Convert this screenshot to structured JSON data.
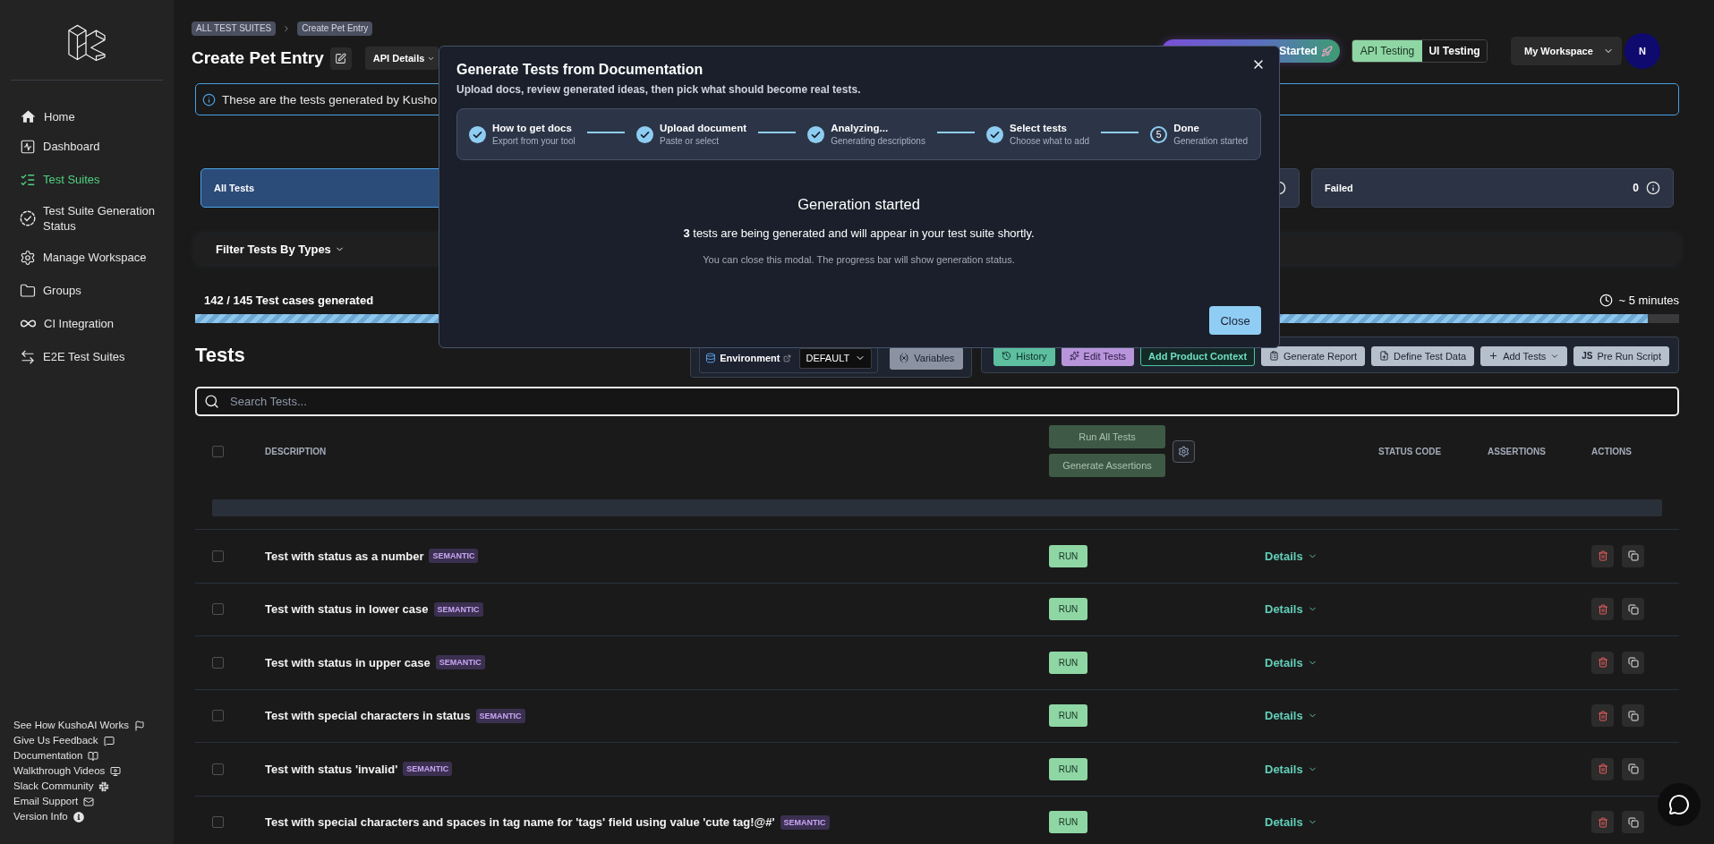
{
  "sidebar": {
    "nav": [
      {
        "label": "Home",
        "selected": false
      },
      {
        "label": "Dashboard",
        "selected": false
      },
      {
        "label": "Test Suites",
        "selected": true
      },
      {
        "label": "Test Suite Generation Status",
        "selected": false
      },
      {
        "label": "Manage Workspace",
        "selected": false
      },
      {
        "label": "Groups",
        "selected": false
      },
      {
        "label": "CI Integration",
        "selected": false
      },
      {
        "label": "E2E Test Suites",
        "selected": false
      }
    ],
    "links": [
      "See How KushoAI Works",
      "Give Us Feedback",
      "Documentation",
      "Walkthrough Videos",
      "Slack Community",
      "Email Support",
      "Version Info"
    ]
  },
  "breadcrumb": [
    "ALL TEST SUITES",
    "Create Pet Entry"
  ],
  "header": {
    "title": "Create Pet Entry",
    "api_details": "API Details",
    "promo": "Started",
    "modes": [
      {
        "label": "API Testing",
        "selected": true
      },
      {
        "label": "UI Testing",
        "selected": false
      }
    ],
    "workspace": "My Workspace",
    "avatar": "N"
  },
  "info_banner": "These are the tests generated by Kusho",
  "stats": [
    {
      "label": "All Tests",
      "selected": true,
      "info_icon": false
    },
    {
      "selected": false,
      "info_icon": true
    },
    {
      "label": "Failed",
      "value": "0",
      "selected": false,
      "info_icon": true
    }
  ],
  "filter": "Filter Tests By Types",
  "progress": {
    "label": "142 / 145 Test cases generated",
    "level": 0.979,
    "eta": "~ 5 minutes"
  },
  "tests": {
    "title": "Tests",
    "environment": {
      "label": "Environment",
      "value": "DEFAULT"
    },
    "variables": "Variables",
    "toolbar": [
      {
        "label": "History",
        "kind": "history"
      },
      {
        "label": "Edit Tests",
        "kind": "edit"
      },
      {
        "label": "Add Product Context",
        "kind": "context"
      },
      {
        "label": "Generate Report",
        "kind": "report"
      },
      {
        "label": "Define Test Data",
        "kind": "data"
      },
      {
        "label": "Add Tests",
        "kind": "add"
      },
      {
        "label": "Pre Run Script",
        "kind": "script",
        "badge": "JS"
      }
    ],
    "search": {
      "placeholder": "Search Tests..."
    }
  },
  "table": {
    "select_all": {
      "checked": false
    },
    "columns": [
      "DESCRIPTION",
      "STATUS CODE",
      "ASSERTIONS",
      "ACTIONS"
    ],
    "run_all": {
      "label": "Run All Tests",
      "disabled": true
    },
    "generate_assertions": {
      "label": "Generate Assertions",
      "disabled": true
    },
    "rows": [
      {
        "description": "Test with status as a number",
        "tag": "SEMANTIC",
        "checked": false,
        "run": "RUN",
        "details": "Details"
      },
      {
        "description": "Test with status in lower case",
        "tag": "SEMANTIC",
        "checked": false,
        "run": "RUN",
        "details": "Details"
      },
      {
        "description": "Test with status in upper case",
        "tag": "SEMANTIC",
        "checked": false,
        "run": "RUN",
        "details": "Details"
      },
      {
        "description": "Test with special characters in status",
        "tag": "SEMANTIC",
        "checked": false,
        "run": "RUN",
        "details": "Details"
      },
      {
        "description": "Test with status 'invalid'",
        "tag": "SEMANTIC",
        "checked": false,
        "run": "RUN",
        "details": "Details"
      },
      {
        "description": "Test with special characters and spaces in tag name for 'tags' field using value 'cute tag!@#'",
        "tag": "SEMANTIC",
        "checked": false,
        "run": "RUN",
        "details": "Details"
      }
    ]
  },
  "modal": {
    "title": "Generate Tests from Documentation",
    "subtitle": "Upload docs, review generated ideas, then pick what should become real tests.",
    "steps": [
      {
        "title": "How to get docs",
        "subtitle": "Export from your tool",
        "completed": true
      },
      {
        "title": "Upload document",
        "subtitle": "Paste or select",
        "completed": true
      },
      {
        "title": "Analyzing...",
        "subtitle": "Generating descriptions",
        "completed": true
      },
      {
        "title": "Select tests",
        "subtitle": "Choose what to add",
        "completed": true
      },
      {
        "title": "Done",
        "subtitle": "Generation started",
        "completed": false,
        "number": "5"
      }
    ],
    "heading": "Generation started",
    "message": "**3** tests are being generated and will appear in your test suite shortly.",
    "note": "You can close this modal. The progress bar will show generation status.",
    "close": "Close"
  }
}
